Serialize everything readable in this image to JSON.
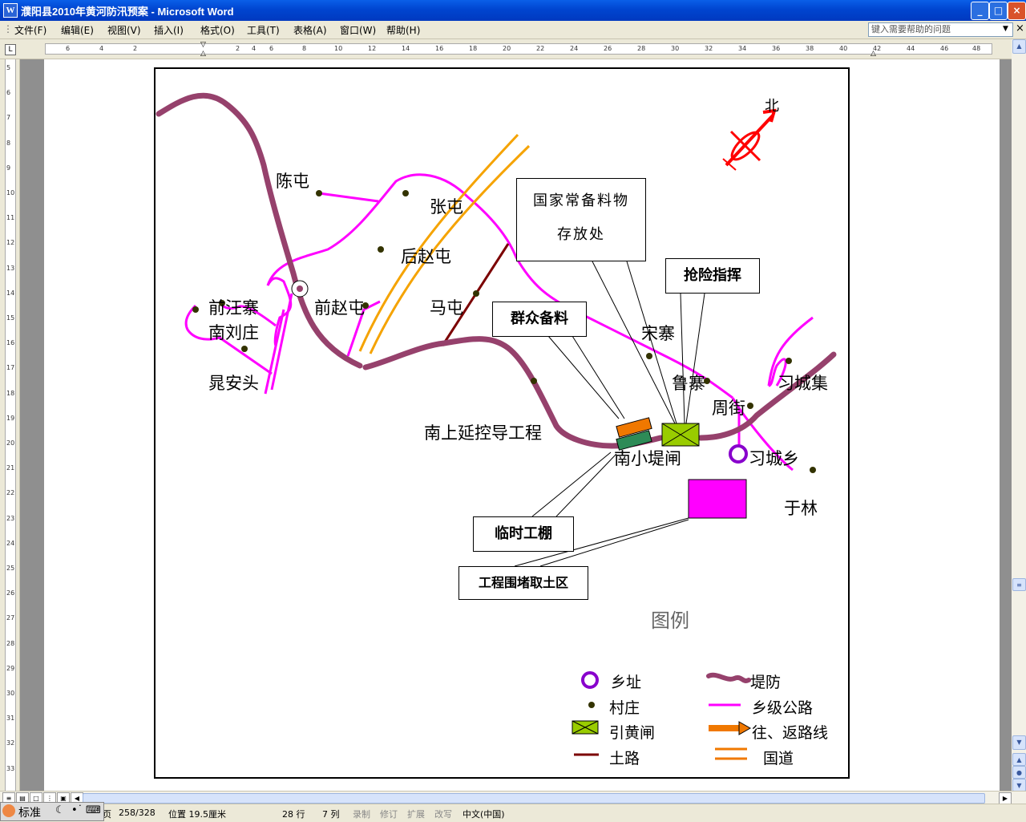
{
  "window": {
    "title": "濮阳县2010年黄河防汛预案 - Microsoft Word",
    "min": "_",
    "max": "□",
    "close": "×"
  },
  "menu": [
    "文件(F)",
    "编辑(E)",
    "视图(V)",
    "插入(I)",
    "格式(O)",
    "工具(T)",
    "表格(A)",
    "窗口(W)",
    "帮助(H)"
  ],
  "help_box": {
    "placeholder": "键入需要帮助的问题"
  },
  "ruler_ticks": [
    "6",
    "4",
    "2",
    "2",
    "4",
    "6",
    "8",
    "10",
    "12",
    "14",
    "16",
    "18",
    "20",
    "22",
    "24",
    "26",
    "28",
    "30",
    "32",
    "34",
    "36",
    "38",
    "40",
    "42",
    "44",
    "46",
    "48"
  ],
  "vruler_ticks": [
    "5",
    "6",
    "7",
    "8",
    "9",
    "10",
    "11",
    "12",
    "13",
    "14",
    "15",
    "16",
    "17",
    "18",
    "19",
    "20",
    "21",
    "22",
    "23",
    "24",
    "25",
    "26",
    "27",
    "28",
    "29",
    "30",
    "31",
    "32",
    "33"
  ],
  "map": {
    "compass": "北",
    "villages": {
      "chentun": "陈屯",
      "zhangtun": "张屯",
      "houzhaotun": "后赵屯",
      "qianzhaotun": "前赵屯",
      "matun": "马屯",
      "qianwangzhai": "前汪寨",
      "nanliuzhuang": "南刘庄",
      "huanganto": "晁安头",
      "songzhai": "宋寨",
      "luzhai": "鲁寨",
      "zhoujie": "周街",
      "xichengji": "习城集",
      "xichengxiang": "习城乡",
      "yulin": "于林",
      "nanxiaodizha": "南小堤闸",
      "nanshang": "南上延控导工程"
    },
    "callouts": {
      "national": [
        "国家常备料物",
        "存放处"
      ],
      "command": "抢险指挥",
      "mass": "群众备料",
      "shed": "临时工棚",
      "borrow": "工程围堵取土区"
    },
    "legend": {
      "title": "图例",
      "items": [
        "乡址",
        "堤防",
        "村庄",
        "乡级公路",
        "引黄闸",
        "往、返路线",
        "土路",
        "国道"
      ]
    },
    "colors": {
      "dike": "#96416c",
      "road": "#ff00ff",
      "national": "#f5a300",
      "dirt": "#7b0000",
      "sluice": "#99cc00",
      "orange": "#f07800",
      "teal": "#2e8b57",
      "magenta": "#ff00ff",
      "north": "#ff0000"
    }
  },
  "status": {
    "page_partial": "页",
    "count": "258/328",
    "position": "位置 19.5厘米",
    "row": "28 行",
    "col": "7 列",
    "rec": "录制",
    "trk": "修订",
    "ext": "扩展",
    "ovr": "改写",
    "lang": "中文(中国)",
    "ime": "标准"
  }
}
